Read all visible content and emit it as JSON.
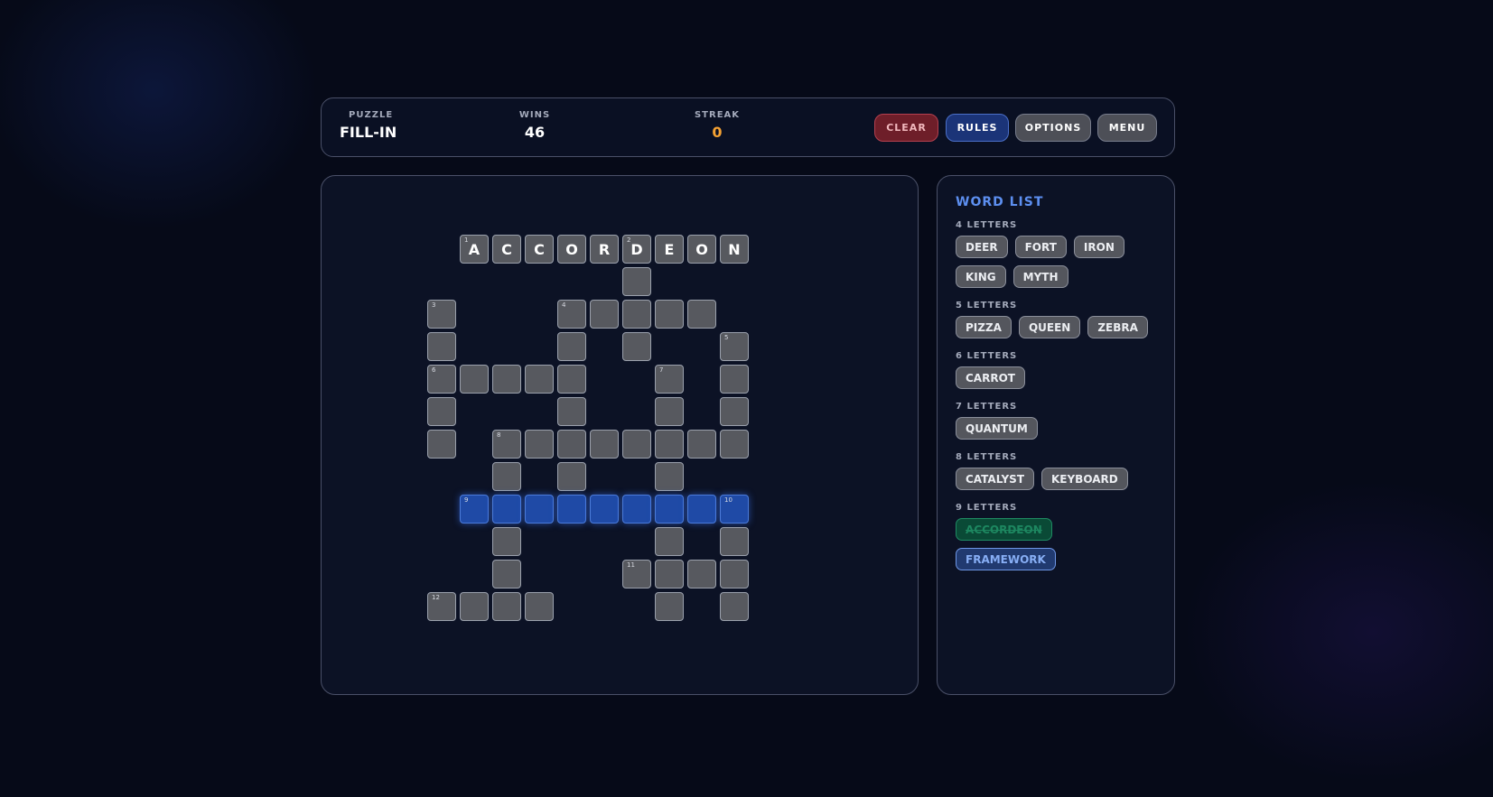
{
  "header": {
    "puzzle_label": "PUZZLE",
    "puzzle_value": "FILL-IN",
    "wins_label": "WINS",
    "wins_value": "46",
    "streak_label": "STREAK",
    "streak_value": "0",
    "buttons": {
      "clear": "CLEAR",
      "rules": "RULES",
      "options": "OPTIONS",
      "menu": "MENU"
    }
  },
  "grid": {
    "cells": [
      {
        "r": 0,
        "c": 1,
        "n": "1",
        "l": "A"
      },
      {
        "r": 0,
        "c": 2,
        "l": "C"
      },
      {
        "r": 0,
        "c": 3,
        "l": "C"
      },
      {
        "r": 0,
        "c": 4,
        "l": "O"
      },
      {
        "r": 0,
        "c": 5,
        "l": "R"
      },
      {
        "r": 0,
        "c": 6,
        "n": "2",
        "l": "D"
      },
      {
        "r": 0,
        "c": 7,
        "l": "E"
      },
      {
        "r": 0,
        "c": 8,
        "l": "O"
      },
      {
        "r": 0,
        "c": 9,
        "l": "N"
      },
      {
        "r": 1,
        "c": 6
      },
      {
        "r": 2,
        "c": 0,
        "n": "3"
      },
      {
        "r": 2,
        "c": 4,
        "n": "4"
      },
      {
        "r": 2,
        "c": 5
      },
      {
        "r": 2,
        "c": 6
      },
      {
        "r": 2,
        "c": 7
      },
      {
        "r": 2,
        "c": 8
      },
      {
        "r": 3,
        "c": 0
      },
      {
        "r": 3,
        "c": 4
      },
      {
        "r": 3,
        "c": 6
      },
      {
        "r": 3,
        "c": 9,
        "n": "5"
      },
      {
        "r": 4,
        "c": 0,
        "n": "6"
      },
      {
        "r": 4,
        "c": 1
      },
      {
        "r": 4,
        "c": 2
      },
      {
        "r": 4,
        "c": 3
      },
      {
        "r": 4,
        "c": 4
      },
      {
        "r": 4,
        "c": 7,
        "n": "7"
      },
      {
        "r": 4,
        "c": 9
      },
      {
        "r": 5,
        "c": 0
      },
      {
        "r": 5,
        "c": 4
      },
      {
        "r": 5,
        "c": 7
      },
      {
        "r": 5,
        "c": 9
      },
      {
        "r": 6,
        "c": 0
      },
      {
        "r": 6,
        "c": 2,
        "n": "8"
      },
      {
        "r": 6,
        "c": 3
      },
      {
        "r": 6,
        "c": 4
      },
      {
        "r": 6,
        "c": 5
      },
      {
        "r": 6,
        "c": 6
      },
      {
        "r": 6,
        "c": 7
      },
      {
        "r": 6,
        "c": 8
      },
      {
        "r": 6,
        "c": 9
      },
      {
        "r": 7,
        "c": 2
      },
      {
        "r": 7,
        "c": 4
      },
      {
        "r": 7,
        "c": 7
      },
      {
        "r": 8,
        "c": 1,
        "n": "9",
        "h": true
      },
      {
        "r": 8,
        "c": 2,
        "h": true
      },
      {
        "r": 8,
        "c": 3,
        "h": true
      },
      {
        "r": 8,
        "c": 4,
        "h": true
      },
      {
        "r": 8,
        "c": 5,
        "h": true
      },
      {
        "r": 8,
        "c": 6,
        "h": true
      },
      {
        "r": 8,
        "c": 7,
        "h": true
      },
      {
        "r": 8,
        "c": 8,
        "h": true
      },
      {
        "r": 8,
        "c": 9,
        "n": "10",
        "h": true
      },
      {
        "r": 9,
        "c": 2
      },
      {
        "r": 9,
        "c": 7
      },
      {
        "r": 9,
        "c": 9
      },
      {
        "r": 10,
        "c": 2
      },
      {
        "r": 10,
        "c": 6,
        "n": "11"
      },
      {
        "r": 10,
        "c": 7
      },
      {
        "r": 10,
        "c": 8
      },
      {
        "r": 10,
        "c": 9
      },
      {
        "r": 11,
        "c": 0,
        "n": "12"
      },
      {
        "r": 11,
        "c": 1
      },
      {
        "r": 11,
        "c": 2
      },
      {
        "r": 11,
        "c": 3
      },
      {
        "r": 11,
        "c": 7
      },
      {
        "r": 11,
        "c": 9
      }
    ]
  },
  "wordlist": {
    "title": "WORD LIST",
    "groups": [
      {
        "label": "4 LETTERS",
        "words": [
          {
            "w": "DEER"
          },
          {
            "w": "FORT"
          },
          {
            "w": "IRON"
          },
          {
            "w": "KING"
          },
          {
            "w": "MYTH"
          }
        ]
      },
      {
        "label": "5 LETTERS",
        "words": [
          {
            "w": "PIZZA"
          },
          {
            "w": "QUEEN"
          },
          {
            "w": "ZEBRA"
          }
        ]
      },
      {
        "label": "6 LETTERS",
        "words": [
          {
            "w": "CARROT"
          }
        ]
      },
      {
        "label": "7 LETTERS",
        "words": [
          {
            "w": "QUANTUM"
          }
        ]
      },
      {
        "label": "8 LETTERS",
        "words": [
          {
            "w": "CATALYST"
          },
          {
            "w": "KEYBOARD"
          }
        ]
      },
      {
        "label": "9 LETTERS",
        "words": [
          {
            "w": "ACCORDEON",
            "state": "done"
          },
          {
            "w": "FRAMEWORK",
            "state": "active"
          }
        ]
      }
    ]
  }
}
